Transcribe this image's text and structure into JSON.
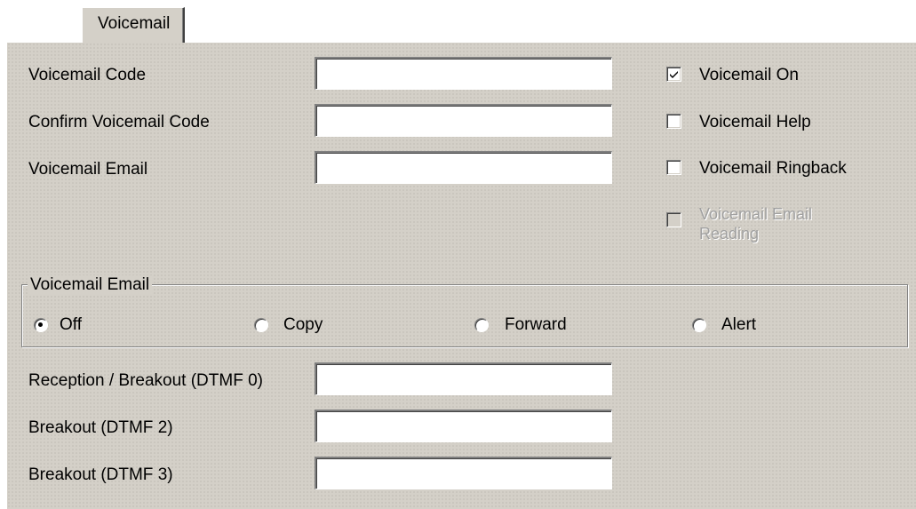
{
  "tab": {
    "label": "Voicemail"
  },
  "fields": {
    "voicemail_code": {
      "label": "Voicemail Code",
      "value": ""
    },
    "confirm_voicemail_code": {
      "label": "Confirm Voicemail Code",
      "value": ""
    },
    "voicemail_email": {
      "label": "Voicemail Email",
      "value": ""
    },
    "reception_breakout": {
      "label": "Reception / Breakout (DTMF 0)",
      "value": ""
    },
    "breakout_2": {
      "label": "Breakout (DTMF 2)",
      "value": ""
    },
    "breakout_3": {
      "label": "Breakout (DTMF 3)",
      "value": ""
    }
  },
  "checkboxes": {
    "voicemail_on": {
      "label": "Voicemail On",
      "checked": true,
      "enabled": true
    },
    "voicemail_help": {
      "label": "Voicemail Help",
      "checked": false,
      "enabled": true
    },
    "voicemail_ringback": {
      "label": "Voicemail Ringback",
      "checked": false,
      "enabled": true
    },
    "voicemail_email_reading": {
      "label": "Voicemail Email Reading",
      "checked": false,
      "enabled": false
    }
  },
  "email_group": {
    "legend": "Voicemail Email",
    "selected": "Off",
    "options": [
      "Off",
      "Copy",
      "Forward",
      "Alert"
    ]
  },
  "colors": {
    "panel_bg": "#d4d0c8",
    "disabled_text": "#a0a0a0"
  }
}
